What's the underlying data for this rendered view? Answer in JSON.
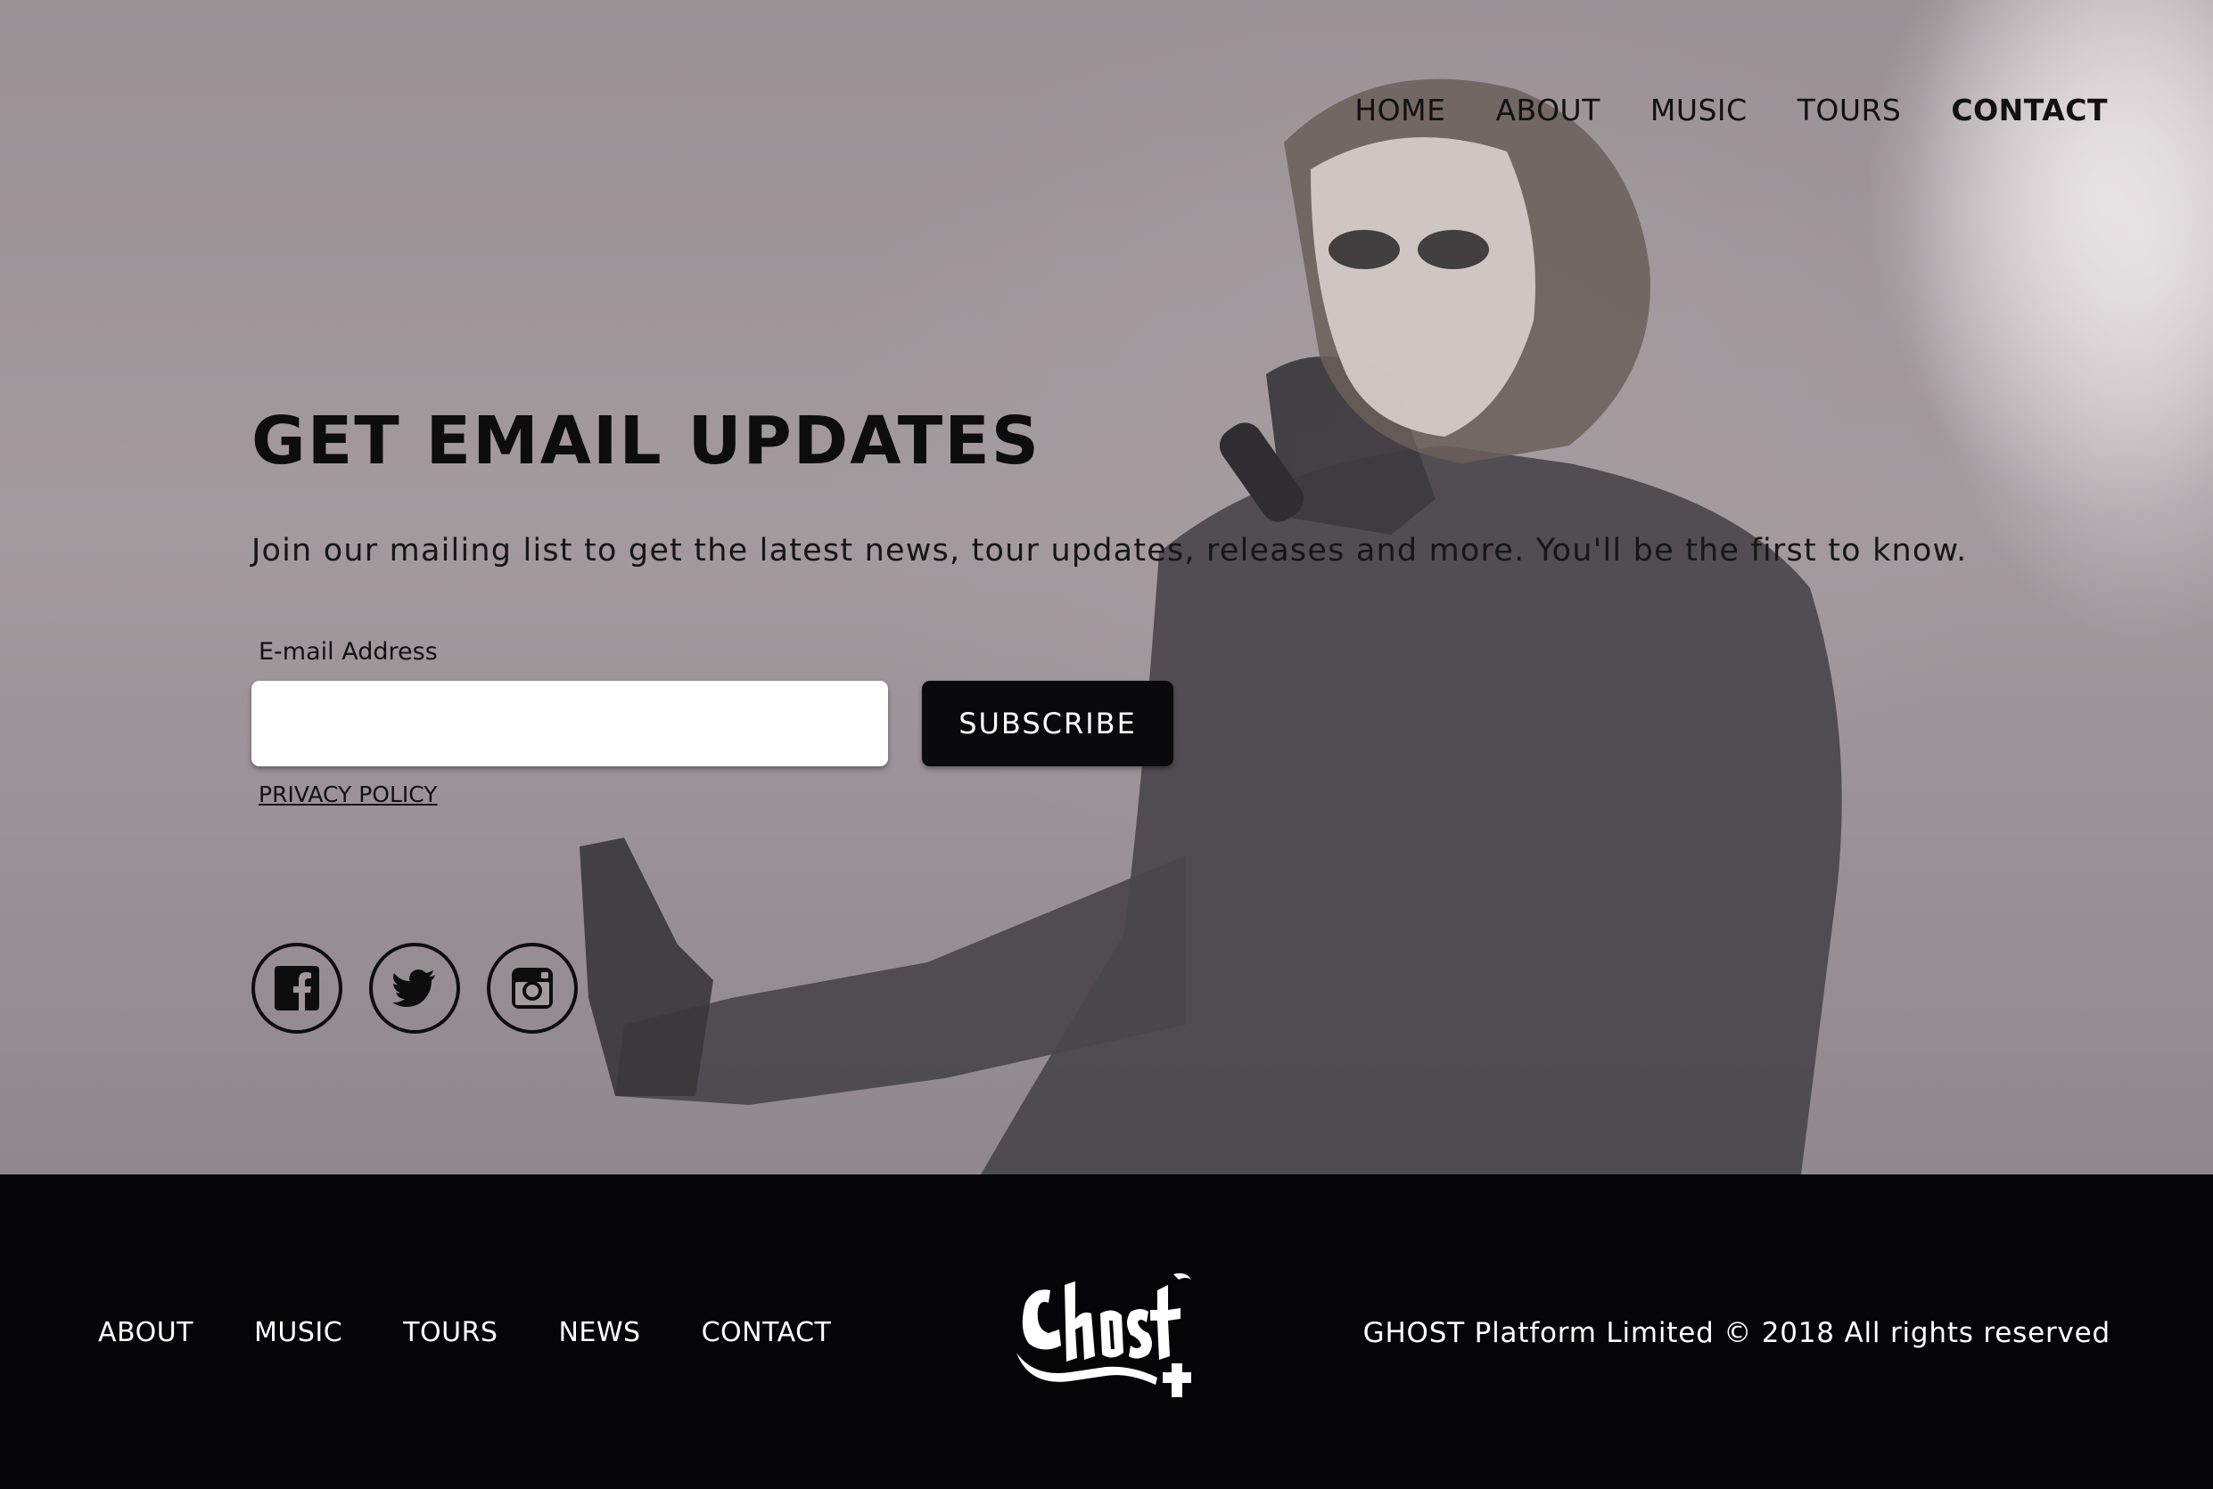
{
  "nav": {
    "items": [
      {
        "label": "HOME"
      },
      {
        "label": "ABOUT"
      },
      {
        "label": "MUSIC"
      },
      {
        "label": "TOURS"
      },
      {
        "label": "CONTACT",
        "active": true
      }
    ]
  },
  "signup": {
    "title": "GET EMAIL UPDATES",
    "description": "Join our mailing list to get the latest news, tour updates, releases and more. You'll be the first to know.",
    "email_label": "E-mail Address",
    "email_value": "",
    "subscribe_label": "SUBSCRIBE",
    "privacy_label": "PRIVACY POLICY"
  },
  "socials": [
    {
      "icon": "facebook-icon"
    },
    {
      "icon": "twitter-icon"
    },
    {
      "icon": "instagram-icon"
    }
  ],
  "footer": {
    "nav": [
      {
        "label": "ABOUT"
      },
      {
        "label": "MUSIC"
      },
      {
        "label": "TOURS"
      },
      {
        "label": "NEWS"
      },
      {
        "label": "CONTACT"
      }
    ],
    "logo_text": "Ghost",
    "copyright": "GHOST Platform Limited © 2018 All rights reserved"
  },
  "colors": {
    "hero_bg": "#9a9195",
    "footer_bg": "#050507",
    "button_bg": "#0a0a0c",
    "text_dark": "#0d0d0d"
  }
}
